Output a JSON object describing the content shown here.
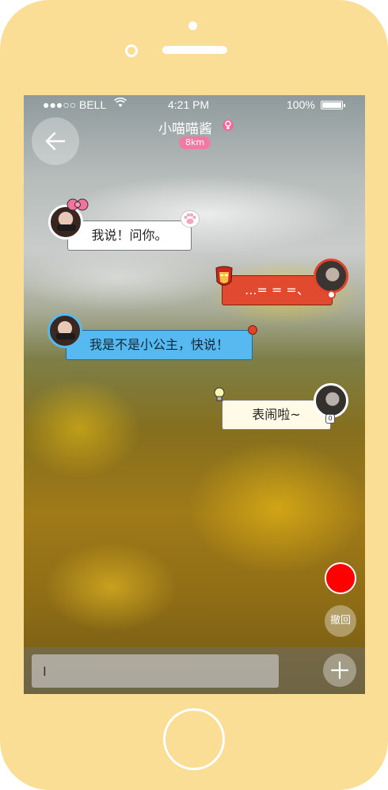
{
  "status_bar": {
    "signal": "●●●○○",
    "carrier": "BELL",
    "time": "4:21 PM",
    "battery": "100%"
  },
  "header": {
    "contact_name": "小喵喵酱",
    "distance": "8km",
    "gender_icon": "female-icon"
  },
  "messages": [
    {
      "side": "left",
      "text": "我说！问你。",
      "bubble_color": "#ffffff"
    },
    {
      "side": "right",
      "text": "...= = =、",
      "bubble_color": "#e24a2f"
    },
    {
      "side": "left",
      "text": "我是不是小公主，快说！",
      "bubble_color": "#56b9ef"
    },
    {
      "side": "right",
      "text": "表闹啦~",
      "bubble_color": "#fffbe6"
    }
  ],
  "controls": {
    "undo_label": "撤回",
    "record_color": "#ff0000"
  },
  "input": {
    "value": "I",
    "placeholder": ""
  },
  "device": {
    "frame_color": "#fbde96"
  }
}
